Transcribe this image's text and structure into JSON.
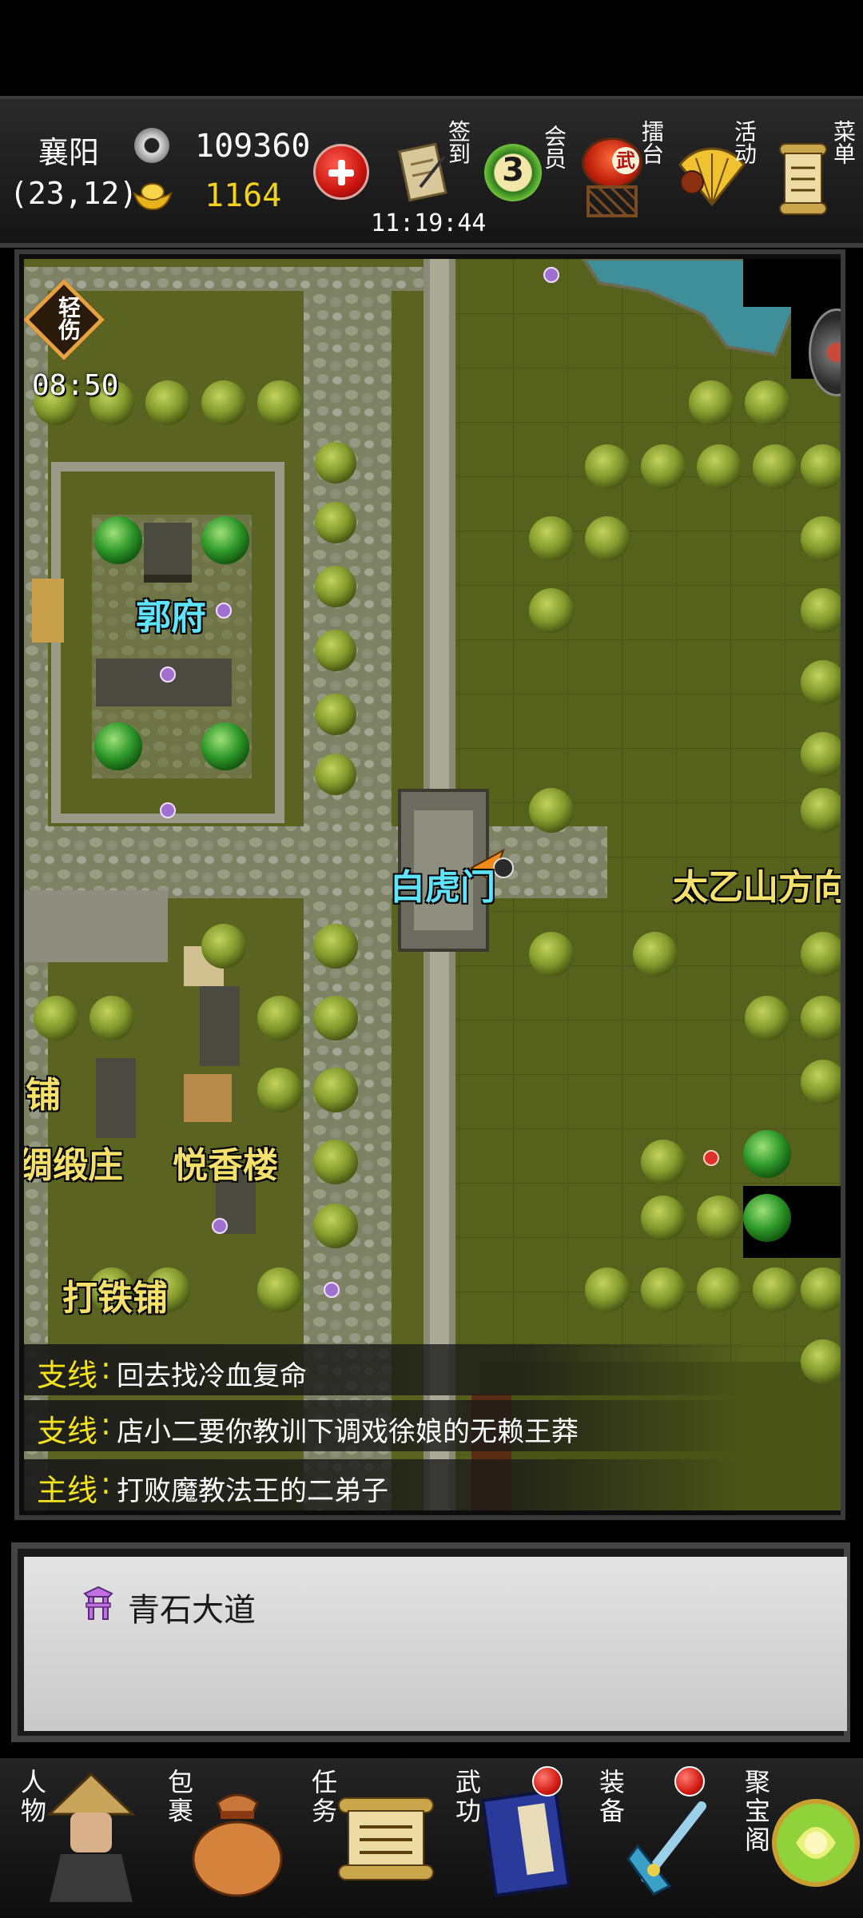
{
  "header": {
    "location": "襄阳",
    "coords": "(23,12)",
    "silver": "109360",
    "gold": "1164",
    "time": "11:19:44"
  },
  "top_menu": [
    {
      "label": "签到",
      "icon": "scroll-sign-in-icon"
    },
    {
      "label": "会员",
      "badge": "3",
      "icon": "vip-badge-icon"
    },
    {
      "label": "擂台",
      "icon": "arena-drum-icon",
      "emblem": "武"
    },
    {
      "label": "活动",
      "icon": "fan-event-icon"
    },
    {
      "label": "菜单",
      "icon": "menu-scroll-icon"
    }
  ],
  "status_effect": {
    "label": "轻伤",
    "timer": "08:50"
  },
  "map_labels": {
    "guo_mansion": "郭府",
    "white_tiger_gate": "白虎门",
    "taiyi_direction": "太乙山方向",
    "shop_partial": "铺",
    "silk_shop": "绸缎庄",
    "yuexiang_tower": "悦香楼",
    "blacksmith": "打铁铺"
  },
  "quests": [
    {
      "type": "支线",
      "text": "回去找冷血复命"
    },
    {
      "type": "支线",
      "text": "店小二要你教训下调戏徐娘的无赖王莽"
    },
    {
      "type": "主线",
      "text": "打败魔教法王的二弟子"
    }
  ],
  "info_panel": {
    "icon": "gate-location-icon",
    "text": "青石大道"
  },
  "bottom_nav": [
    {
      "label": "人物",
      "icon": "character-icon"
    },
    {
      "label": "包裹",
      "icon": "bag-icon"
    },
    {
      "label": "任务",
      "icon": "quest-scroll-icon"
    },
    {
      "label": "武功",
      "icon": "martial-arts-book-icon",
      "notify": true
    },
    {
      "label": "装备",
      "icon": "equipment-sword-icon",
      "notify": true
    },
    {
      "label": "聚宝阁",
      "icon": "treasure-shop-icon"
    }
  ],
  "colors": {
    "quest_type": "#f4e31c",
    "map_label_blue": "#5fe4ff",
    "map_label_yellow": "#f4e06a",
    "grass": "#56611c"
  }
}
